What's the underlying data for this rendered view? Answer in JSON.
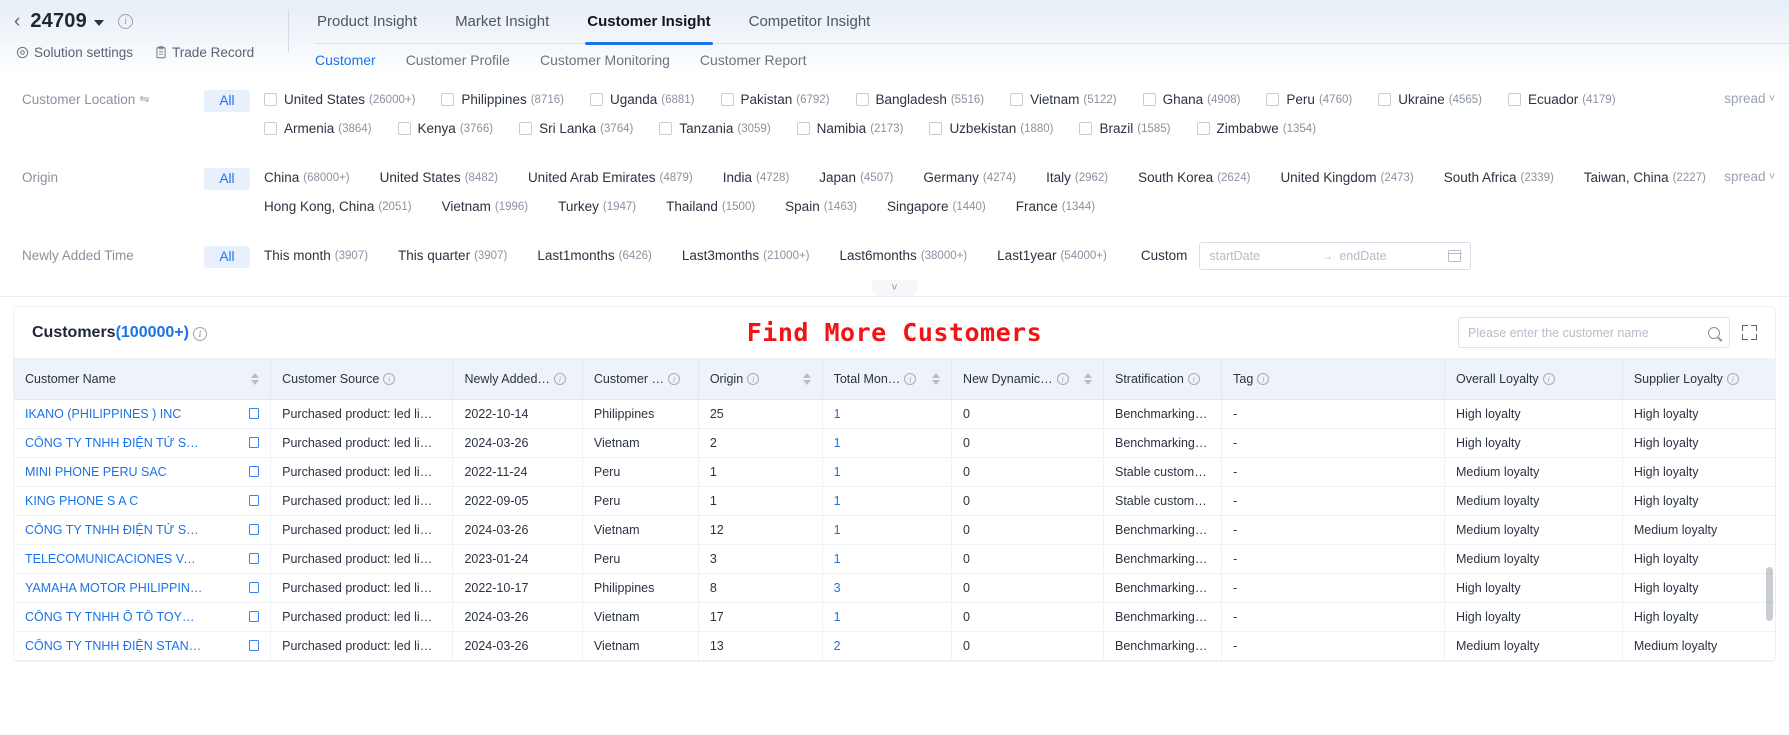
{
  "header": {
    "solution_id": "24709",
    "back_icon": "chevron-left-icon",
    "caret_icon": "caret-down-icon",
    "info_icon": "info-circle-icon",
    "links": [
      {
        "label": "Solution settings",
        "icon": "settings-gear-icon"
      },
      {
        "label": "Trade Record",
        "icon": "clipboard-icon"
      }
    ],
    "main_tabs": [
      {
        "label": "Product Insight",
        "active": false
      },
      {
        "label": "Market Insight",
        "active": false
      },
      {
        "label": "Customer Insight",
        "active": true
      },
      {
        "label": "Competitor Insight",
        "active": false
      }
    ],
    "sub_tabs": [
      {
        "label": "Customer",
        "active": true
      },
      {
        "label": "Customer Profile",
        "active": false
      },
      {
        "label": "Customer Monitoring",
        "active": false
      },
      {
        "label": "Customer Report",
        "active": false
      }
    ]
  },
  "filters": {
    "spread_label": "spread",
    "customer_location": {
      "label": "Customer Location",
      "sort_icon": "sort-icon",
      "all_label": "All",
      "items": [
        {
          "name": "United States",
          "count": "(26000+)"
        },
        {
          "name": "Philippines",
          "count": "(8716)"
        },
        {
          "name": "Uganda",
          "count": "(6881)"
        },
        {
          "name": "Pakistan",
          "count": "(6792)"
        },
        {
          "name": "Bangladesh",
          "count": "(5516)"
        },
        {
          "name": "Vietnam",
          "count": "(5122)"
        },
        {
          "name": "Ghana",
          "count": "(4908)"
        },
        {
          "name": "Peru",
          "count": "(4760)"
        },
        {
          "name": "Ukraine",
          "count": "(4565)"
        },
        {
          "name": "Ecuador",
          "count": "(4179)"
        },
        {
          "name": "Armenia",
          "count": "(3864)"
        },
        {
          "name": "Kenya",
          "count": "(3766)"
        },
        {
          "name": "Sri Lanka",
          "count": "(3764)"
        },
        {
          "name": "Tanzania",
          "count": "(3059)"
        },
        {
          "name": "Namibia",
          "count": "(2173)"
        },
        {
          "name": "Uzbekistan",
          "count": "(1880)"
        },
        {
          "name": "Brazil",
          "count": "(1585)"
        },
        {
          "name": "Zimbabwe",
          "count": "(1354)"
        }
      ]
    },
    "origin": {
      "label": "Origin",
      "all_label": "All",
      "items": [
        {
          "name": "China",
          "count": "(68000+)"
        },
        {
          "name": "United States",
          "count": "(8482)"
        },
        {
          "name": "United Arab Emirates",
          "count": "(4879)"
        },
        {
          "name": "India",
          "count": "(4728)"
        },
        {
          "name": "Japan",
          "count": "(4507)"
        },
        {
          "name": "Germany",
          "count": "(4274)"
        },
        {
          "name": "Italy",
          "count": "(2962)"
        },
        {
          "name": "South Korea",
          "count": "(2624)"
        },
        {
          "name": "United Kingdom",
          "count": "(2473)"
        },
        {
          "name": "South Africa",
          "count": "(2339)"
        },
        {
          "name": "Taiwan, China",
          "count": "(2227)"
        },
        {
          "name": "Hong Kong, China",
          "count": "(2051)"
        },
        {
          "name": "Vietnam",
          "count": "(1996)"
        },
        {
          "name": "Turkey",
          "count": "(1947)"
        },
        {
          "name": "Thailand",
          "count": "(1500)"
        },
        {
          "name": "Spain",
          "count": "(1463)"
        },
        {
          "name": "Singapore",
          "count": "(1440)"
        },
        {
          "name": "France",
          "count": "(1344)"
        }
      ]
    },
    "newly_added_time": {
      "label": "Newly Added Time",
      "all_label": "All",
      "items": [
        {
          "name": "This month",
          "count": "(3907)"
        },
        {
          "name": "This quarter",
          "count": "(3907)"
        },
        {
          "name": "Last1months",
          "count": "(6426)"
        },
        {
          "name": "Last3months",
          "count": "(21000+)"
        },
        {
          "name": "Last6months",
          "count": "(38000+)"
        },
        {
          "name": "Last1year",
          "count": "(54000+)"
        }
      ],
      "custom_label": "Custom",
      "start_placeholder": "startDate",
      "end_placeholder": "endDate",
      "range_arrow": "→",
      "calendar_icon": "calendar-icon"
    },
    "collapse_icon": "chevron-down-icon"
  },
  "panel": {
    "title": "Customers",
    "count": "(100000+)",
    "info_icon": "info-circle-icon",
    "annotation": "Find More Customers",
    "annotation_color": "#f21414",
    "search_placeholder": "Please enter the customer name",
    "search_value": "",
    "search_icon": "search-icon",
    "fullscreen_icon": "expand-icon"
  },
  "table": {
    "columns": [
      {
        "label": "Customer Name",
        "sortable": true,
        "info": false
      },
      {
        "label": "Customer Source",
        "sortable": false,
        "info": true
      },
      {
        "label": "Newly Added…",
        "sortable": false,
        "info": true
      },
      {
        "label": "Customer …",
        "sortable": false,
        "info": true
      },
      {
        "label": "Origin",
        "sortable": true,
        "info": true
      },
      {
        "label": "Total Mon…",
        "sortable": true,
        "info": true
      },
      {
        "label": "New Dynamic…",
        "sortable": true,
        "info": true
      },
      {
        "label": "Stratification",
        "sortable": false,
        "info": true
      },
      {
        "label": "Tag",
        "sortable": false,
        "info": true
      },
      {
        "label": "Overall Loyalty",
        "sortable": false,
        "info": true
      },
      {
        "label": "Supplier Loyalty",
        "sortable": false,
        "info": true
      }
    ],
    "rows": [
      {
        "name": "IKANO (PHILIPPINES ) INC",
        "source": "Purchased product: led li…",
        "added": "2022-10-14",
        "location": "Philippines",
        "origin": "25",
        "total_month": "1",
        "new_dynamic": "0",
        "stratification": "Benchmarking …",
        "tag": "-",
        "overall_loyalty": "High loyalty",
        "supplier_loyalty": "High loyalty"
      },
      {
        "name": "CÔNG TY TNHH ĐIỆN TỬ SNC …",
        "source": "Purchased product: led li…",
        "added": "2024-03-26",
        "location": "Vietnam",
        "origin": "2",
        "total_month": "1",
        "new_dynamic": "0",
        "stratification": "Benchmarking …",
        "tag": "-",
        "overall_loyalty": "High loyalty",
        "supplier_loyalty": "High loyalty"
      },
      {
        "name": "MINI PHONE PERU SAC",
        "source": "Purchased product: led li…",
        "added": "2022-11-24",
        "location": "Peru",
        "origin": "1",
        "total_month": "1",
        "new_dynamic": "0",
        "stratification": "Stable custome…",
        "tag": "-",
        "overall_loyalty": "Medium loyalty",
        "supplier_loyalty": "High loyalty"
      },
      {
        "name": "KING PHONE S A C",
        "source": "Purchased product: led li…",
        "added": "2022-09-05",
        "location": "Peru",
        "origin": "1",
        "total_month": "1",
        "new_dynamic": "0",
        "stratification": "Stable custome…",
        "tag": "-",
        "overall_loyalty": "Medium loyalty",
        "supplier_loyalty": "High loyalty"
      },
      {
        "name": "CÔNG TY TNHH ĐIỆN TỬ SAM…",
        "source": "Purchased product: led li…",
        "added": "2024-03-26",
        "location": "Vietnam",
        "origin": "12",
        "total_month": "1",
        "new_dynamic": "0",
        "stratification": "Benchmarking …",
        "tag": "-",
        "overall_loyalty": "Medium loyalty",
        "supplier_loyalty": "Medium loyalty"
      },
      {
        "name": "TELECOMUNICACIONES VALL…",
        "source": "Purchased product: led li…",
        "added": "2023-01-24",
        "location": "Peru",
        "origin": "3",
        "total_month": "1",
        "new_dynamic": "0",
        "stratification": "Benchmarking …",
        "tag": "-",
        "overall_loyalty": "Medium loyalty",
        "supplier_loyalty": "High loyalty"
      },
      {
        "name": "YAMAHA MOTOR PHILIPPINE…",
        "source": "Purchased product: led li…",
        "added": "2022-10-17",
        "location": "Philippines",
        "origin": "8",
        "total_month": "3",
        "new_dynamic": "0",
        "stratification": "Benchmarking …",
        "tag": "-",
        "overall_loyalty": "High loyalty",
        "supplier_loyalty": "High loyalty"
      },
      {
        "name": "CÔNG TY TNHH Ô TÔ TOYOTA VIỆT …",
        "source": "Purchased product: led li…",
        "added": "2024-03-26",
        "location": "Vietnam",
        "origin": "17",
        "total_month": "1",
        "new_dynamic": "0",
        "stratification": "Benchmarking …",
        "tag": "-",
        "overall_loyalty": "High loyalty",
        "supplier_loyalty": "High loyalty"
      },
      {
        "name": "CÔNG TY TNHH ĐIỆN STANLE…",
        "source": "Purchased product: led li…",
        "added": "2024-03-26",
        "location": "Vietnam",
        "origin": "13",
        "total_month": "2",
        "new_dynamic": "0",
        "stratification": "Benchmarking …",
        "tag": "-",
        "overall_loyalty": "Medium loyalty",
        "supplier_loyalty": "Medium loyalty"
      }
    ]
  }
}
